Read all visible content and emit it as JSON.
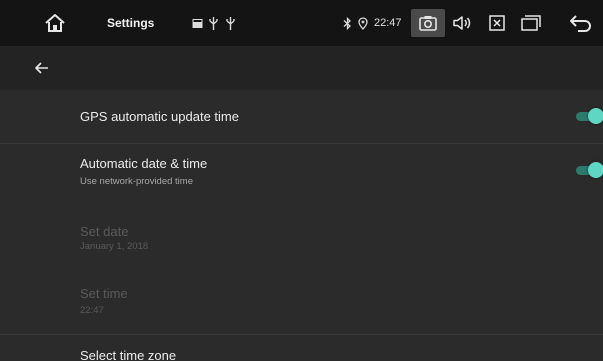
{
  "statusbar": {
    "title": "Settings",
    "time": "22:47",
    "icons": [
      "home-icon",
      "image-icon",
      "usb-icon",
      "usb-icon",
      "bluetooth-icon",
      "location-icon",
      "camera-icon",
      "volume-icon",
      "close-box-icon",
      "recent-apps-icon",
      "back-icon"
    ]
  },
  "actionbar": {
    "icon": "arrow-left-icon"
  },
  "rows": {
    "gps": {
      "title": "GPS automatic update time",
      "enabled": true
    },
    "auto": {
      "title": "Automatic date & time",
      "subtitle": "Use network-provided time",
      "enabled": true
    },
    "set_date": {
      "title": "Set date",
      "subtitle": "January 1, 2018"
    },
    "set_time": {
      "title": "Set time",
      "subtitle": "22:47"
    },
    "time_zone": {
      "title": "Select time zone"
    }
  },
  "colors": {
    "accent": "#5fd6c4",
    "accent_track": "#2d7a6e",
    "statusbar": "#141414",
    "actionbar": "#232323",
    "background": "#2b2b2b"
  }
}
